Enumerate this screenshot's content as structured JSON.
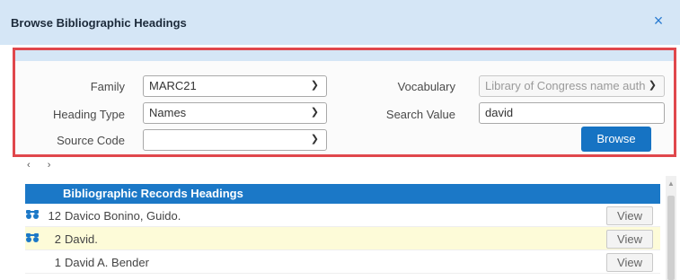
{
  "dialog": {
    "title": "Browse Bibliographic Headings",
    "close_icon": "×"
  },
  "form": {
    "family_label": "Family",
    "family_value": "MARC21",
    "heading_type_label": "Heading Type",
    "heading_type_value": "Names",
    "source_code_label": "Source Code",
    "source_code_value": "",
    "vocabulary_label": "Vocabulary",
    "vocabulary_value": "Library of Congress name auth",
    "search_value_label": "Search Value",
    "search_value": "david",
    "browse_label": "Browse"
  },
  "pager": {
    "prev": "‹",
    "next": "›"
  },
  "results": {
    "header": "Bibliographic Records Headings",
    "rows": [
      {
        "count": "12",
        "name": "Davico Bonino, Guido.",
        "view": "View",
        "has_icon": true,
        "highlight": false
      },
      {
        "count": "2",
        "name": "David.",
        "view": "View",
        "has_icon": true,
        "highlight": true
      },
      {
        "count": "1",
        "name": "David A. Bender",
        "view": "View",
        "has_icon": false,
        "highlight": false
      }
    ]
  },
  "icons": {
    "row_icon": "binoculars-icon",
    "chevron": "chevron-down-icon"
  },
  "colors": {
    "title_bar": "#d5e6f6",
    "accent": "#1673c3",
    "panel_border": "#e0474c",
    "highlight_row": "#fdfbd8"
  }
}
